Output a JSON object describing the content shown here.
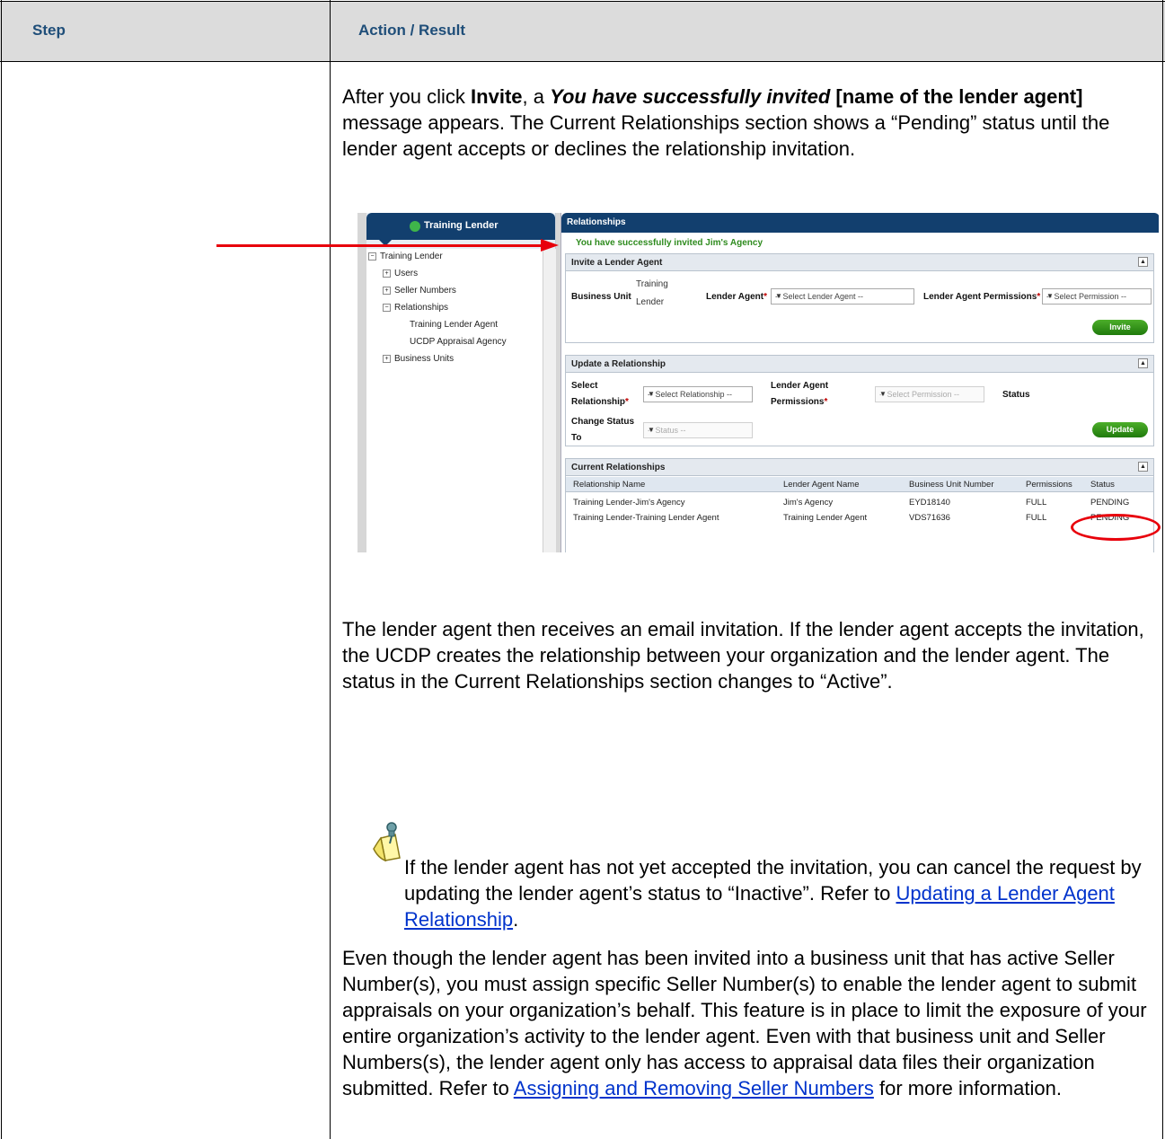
{
  "table": {
    "step_header": "Step",
    "action_header": "Action / Result"
  },
  "intro": {
    "p1_a": "After you click ",
    "p1_invite": "Invite",
    "p1_b": ", a ",
    "p1_italic": "You have successfully invited",
    "p1_bold": " [name of the lender agent]",
    "p1_c": " message appears.  The Current Relationships section shows a “Pending” status until the lender agent accepts or declines the relationship invitation."
  },
  "screenshot": {
    "nav_title": "Training Lender",
    "tree": [
      {
        "label": "Training Lender",
        "marker": "−"
      },
      {
        "label": "Users",
        "marker": "+"
      },
      {
        "label": "Seller Numbers",
        "marker": "+"
      },
      {
        "label": "Relationships",
        "marker": "−"
      },
      {
        "label": "Training Lender Agent",
        "marker": ""
      },
      {
        "label": "UCDP Appraisal Agency",
        "marker": ""
      },
      {
        "label": "Business Units",
        "marker": "+"
      }
    ],
    "panel_title": "Relationships",
    "success_message": "You have successfully invited Jim's Agency",
    "invite": {
      "title": "Invite a Lender Agent",
      "business_unit_label": "Business Unit",
      "business_unit_value_1": "Training",
      "business_unit_value_2": "Lender",
      "lender_agent_label": "Lender Agent",
      "lender_agent_placeholder": "-- Select Lender Agent --",
      "permissions_label": "Lender Agent Permissions",
      "permissions_placeholder": "-- Select Permission --",
      "button": "Invite"
    },
    "update": {
      "title": "Update a Relationship",
      "select_label_1": "Select",
      "select_label_2": "Relationship",
      "select_placeholder": "-- Select Relationship --",
      "perm_label_1": "Lender Agent",
      "perm_label_2": "Permissions",
      "perm_placeholder": "-- Select Permission --",
      "status_label": "Status",
      "change_label_1": "Change Status",
      "change_label_2": "To",
      "status_placeholder": "-- Status --",
      "button": "Update"
    },
    "current": {
      "title": "Current Relationships",
      "columns": [
        "Relationship Name",
        "Lender Agent Name",
        "Business Unit Number",
        "Permissions",
        "Status"
      ],
      "rows": [
        [
          "Training Lender-Jim's Agency",
          "Jim's Agency",
          "EYD18140",
          "FULL",
          "PENDING"
        ],
        [
          "Training Lender-Training Lender Agent",
          "Training Lender Agent",
          "VDS71636",
          "FULL",
          "PENDING"
        ]
      ]
    }
  },
  "para2": "The lender agent then receives an email invitation.  If the lender agent accepts the invitation, the UCDP creates the relationship between your organization and the lender agent.  The status in the Current Relationships section changes to “Active”.",
  "note": {
    "text": "If the lender agent has not yet accepted the invitation, you can cancel the request by updating the lender agent’s status to “Inactive”.  Refer to ",
    "link": "Updating a Lender Agent Relationship",
    "end": "."
  },
  "para3": {
    "text": "Even though the lender agent has been invited into a business unit that has active Seller Number(s), you must assign specific Seller Number(s) to enable the lender agent to submit appraisals on your organization’s behalf. This feature is in place to limit the exposure of your entire organization’s activity to the lender agent.  Even with that business unit and Seller Numbers(s), the lender agent only has access to appraisal data files their organization submitted.  Refer to ",
    "link": "Assigning and Removing Seller Numbers",
    "end": " for more information."
  },
  "colors": {
    "header_text": "#1f4e79",
    "header_bg": "#dcdcdc",
    "arrow": "#e8000b",
    "link": "#0033cc",
    "success": "#2e8b1e"
  }
}
